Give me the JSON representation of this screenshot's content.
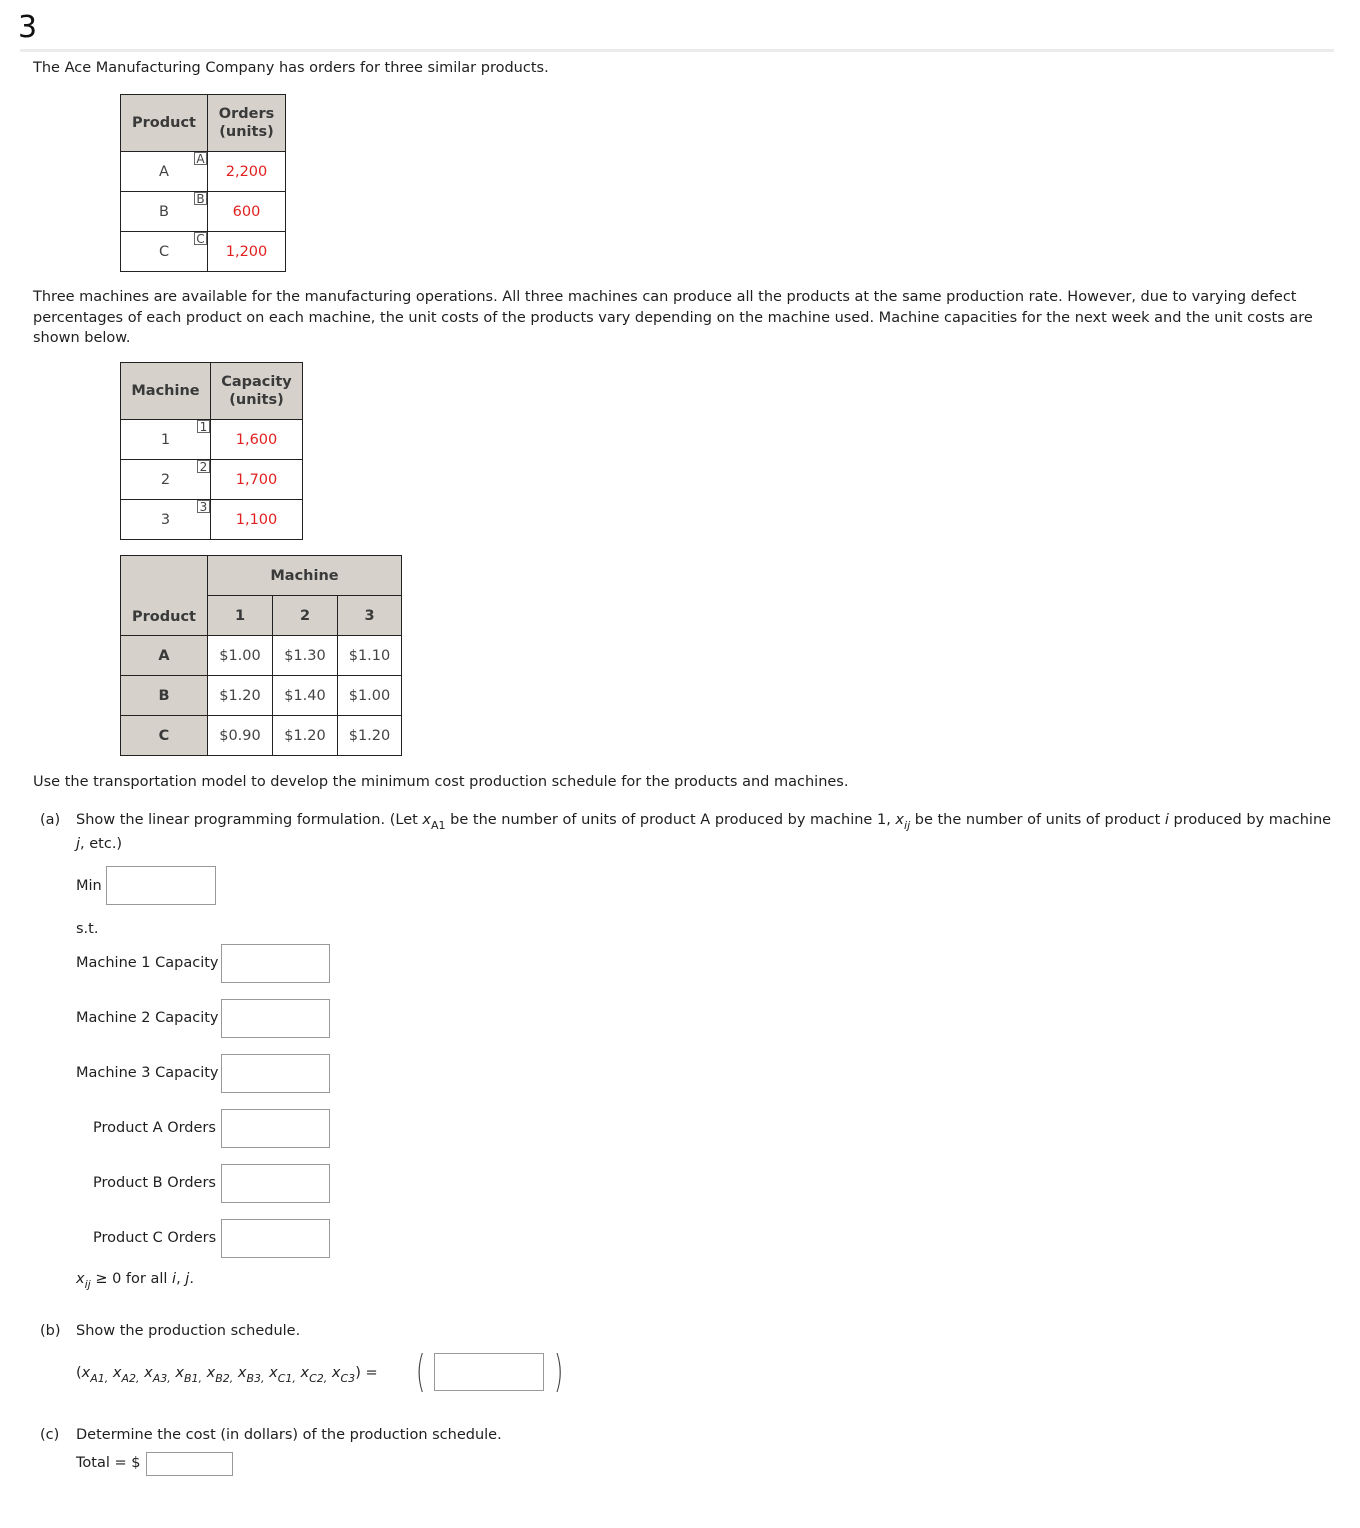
{
  "question": {
    "number": "3",
    "intro": "The Ace Manufacturing Company has orders for three similar products.",
    "orders_table": {
      "headers": [
        "Product",
        "Orders",
        "(units)"
      ],
      "rows": [
        {
          "product": "A",
          "tag": "A",
          "orders": "2,200"
        },
        {
          "product": "B",
          "tag": "B",
          "orders": "600"
        },
        {
          "product": "C",
          "tag": "C",
          "orders": "1,200"
        }
      ]
    },
    "machines_paragraph_line1": "Three machines are available for the manufacturing operations. All three machines can produce all the products at the same production rate. However, due to varying defect",
    "machines_paragraph_line2": "percentages of each product on each machine, the unit costs of the products vary depending on the machine used. Machine capacities for the next week and the unit costs are",
    "machines_paragraph_line3": "shown below.",
    "capacity_table": {
      "headers": [
        "Machine",
        "Capacity",
        "(units)"
      ],
      "rows": [
        {
          "machine": "1",
          "tag": "1",
          "capacity": "1,600"
        },
        {
          "machine": "2",
          "tag": "2",
          "capacity": "1,700"
        },
        {
          "machine": "3",
          "tag": "3",
          "capacity": "1,100"
        }
      ]
    },
    "cost_table": {
      "group_header": "Machine",
      "row_header": "Product",
      "machines": [
        "1",
        "2",
        "3"
      ],
      "rows": [
        {
          "product": "A",
          "costs": [
            "$1.00",
            "$1.30",
            "$1.10"
          ]
        },
        {
          "product": "B",
          "costs": [
            "$1.20",
            "$1.40",
            "$1.00"
          ]
        },
        {
          "product": "C",
          "costs": [
            "$0.90",
            "$1.20",
            "$1.20"
          ]
        }
      ]
    },
    "transport_instruction": "Use the transportation model to develop the minimum cost production schedule for the products and machines."
  },
  "part_a": {
    "label": "(a)",
    "text_1": "Show the linear programming formulation. (Let ",
    "var_x": "x",
    "var_sub_A1": "A1",
    "text_2": " be the number of units of product A produced by machine 1, ",
    "var_sub_ij": "ij",
    "text_3": " be the number of units of product ",
    "var_i": "i",
    "text_4": " produced by machine",
    "line2_j": "j",
    "line2_rest": ", etc.)",
    "min_label": "Min",
    "min_value": "",
    "st_label": "s.t.",
    "constraints": [
      {
        "label": "Machine 1 Capacity",
        "value": ""
      },
      {
        "label": "Machine 2 Capacity",
        "value": ""
      },
      {
        "label": "Machine 3 Capacity",
        "value": ""
      },
      {
        "label": "Product A Orders",
        "value": ""
      },
      {
        "label": "Product B Orders",
        "value": ""
      },
      {
        "label": "Product C Orders",
        "value": ""
      }
    ],
    "nonneg_rest": " ≥ 0 for all ",
    "nonneg_i": "i",
    "nonneg_sep": ", ",
    "nonneg_j": "j",
    "nonneg_end": "."
  },
  "part_b": {
    "label": "(b)",
    "text": "Show the production schedule.",
    "vars": [
      "A1",
      "A2",
      "A3",
      "B1",
      "B2",
      "B3",
      "C1",
      "C2",
      "C3"
    ],
    "equals": "=",
    "value": ""
  },
  "part_c": {
    "label": "(c)",
    "text": "Determine the cost (in dollars) of the production schedule.",
    "total_label": "Total = $",
    "value": ""
  }
}
